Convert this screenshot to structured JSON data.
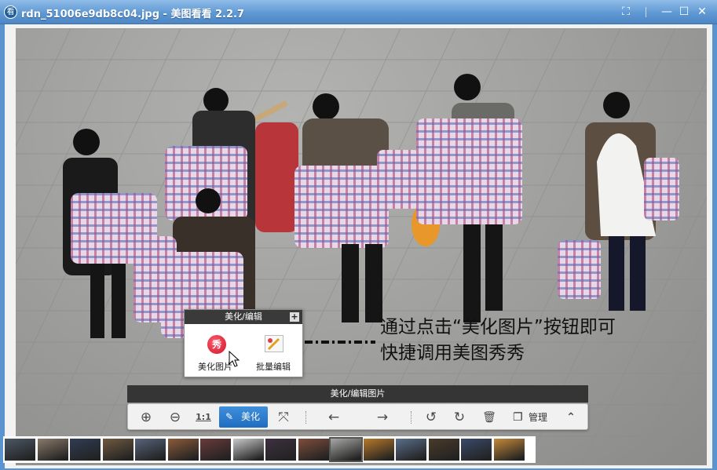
{
  "window": {
    "app_icon": "看",
    "title": "rdn_51006e9db8c04.jpg - 美图看看 2.2.7",
    "buttons": {
      "fullscreen": "⛶",
      "minimize": "—",
      "maximize": "☐",
      "close": "✕"
    }
  },
  "popup": {
    "title": "美化/编辑",
    "plus": "+",
    "items": [
      {
        "label": "美化图片",
        "icon": "秀"
      },
      {
        "label": "批量编辑",
        "icon": "batch-edit"
      }
    ]
  },
  "caption": {
    "line1": "通过点击“美化图片”按钮即可",
    "line2": "快捷调用美图秀秀"
  },
  "toolbar": {
    "title": "美化/编辑图片",
    "zoom_in": "⊕",
    "zoom_out": "⊖",
    "actual_size": "1:1",
    "beautify": "美化",
    "fit": "⤧",
    "prev": "←",
    "next": "→",
    "rotate_left": "↺",
    "rotate_right": "↻",
    "delete": "🗑",
    "manage": "管理",
    "collapse": "⌃"
  },
  "filmstrip": {
    "selected_index": 10,
    "thumb_colors": [
      "#4c5866",
      "#8a7a6a",
      "#2f3d55",
      "#705a40",
      "#56647a",
      "#8c5b3a",
      "#6a3a3a",
      "#c9c9c9",
      "#3e3140",
      "#7f4e3b",
      "#a8a8a6",
      "#b87a2a",
      "#5a6e8a",
      "#4a3b2a",
      "#3a4a6a",
      "#c48a3a"
    ],
    "colors": {
      "selected_border": "#555555"
    }
  }
}
